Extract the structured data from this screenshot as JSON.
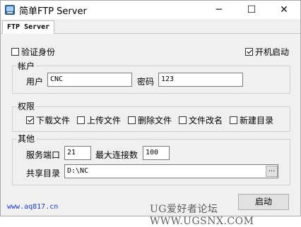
{
  "window": {
    "title": "简单FTP Server",
    "minimize_glyph": "─",
    "maximize_glyph": "☐",
    "close_glyph": "✕",
    "icon": "ftp-app-icon"
  },
  "tabs": [
    {
      "label": "FTP Server",
      "selected": true
    }
  ],
  "options": {
    "auth_label": "验证身份",
    "auth_checked": false,
    "autostart_label": "开机启动",
    "autostart_checked": true
  },
  "account": {
    "group_title": "帐户",
    "user_label": "用户",
    "user_value": "CNC",
    "password_label": "密码",
    "password_value": "123"
  },
  "permissions": {
    "group_title": "权限",
    "items": [
      {
        "label": "下载文件",
        "checked": true
      },
      {
        "label": "上传文件",
        "checked": false
      },
      {
        "label": "删除文件",
        "checked": false
      },
      {
        "label": "文件改名",
        "checked": false
      },
      {
        "label": "新建目录",
        "checked": false
      }
    ]
  },
  "other": {
    "group_title": "其他",
    "port_label": "服务端口",
    "port_value": "21",
    "maxconn_label": "最大连接数",
    "maxconn_value": "100",
    "share_label": "共享目录",
    "share_value": "D:\\NC",
    "browse_label": "..."
  },
  "footer": {
    "start_label": "启动",
    "url": "www.aq817.cn",
    "watermark": "UG爱好者论坛 WWW.UGSNX.COM"
  }
}
